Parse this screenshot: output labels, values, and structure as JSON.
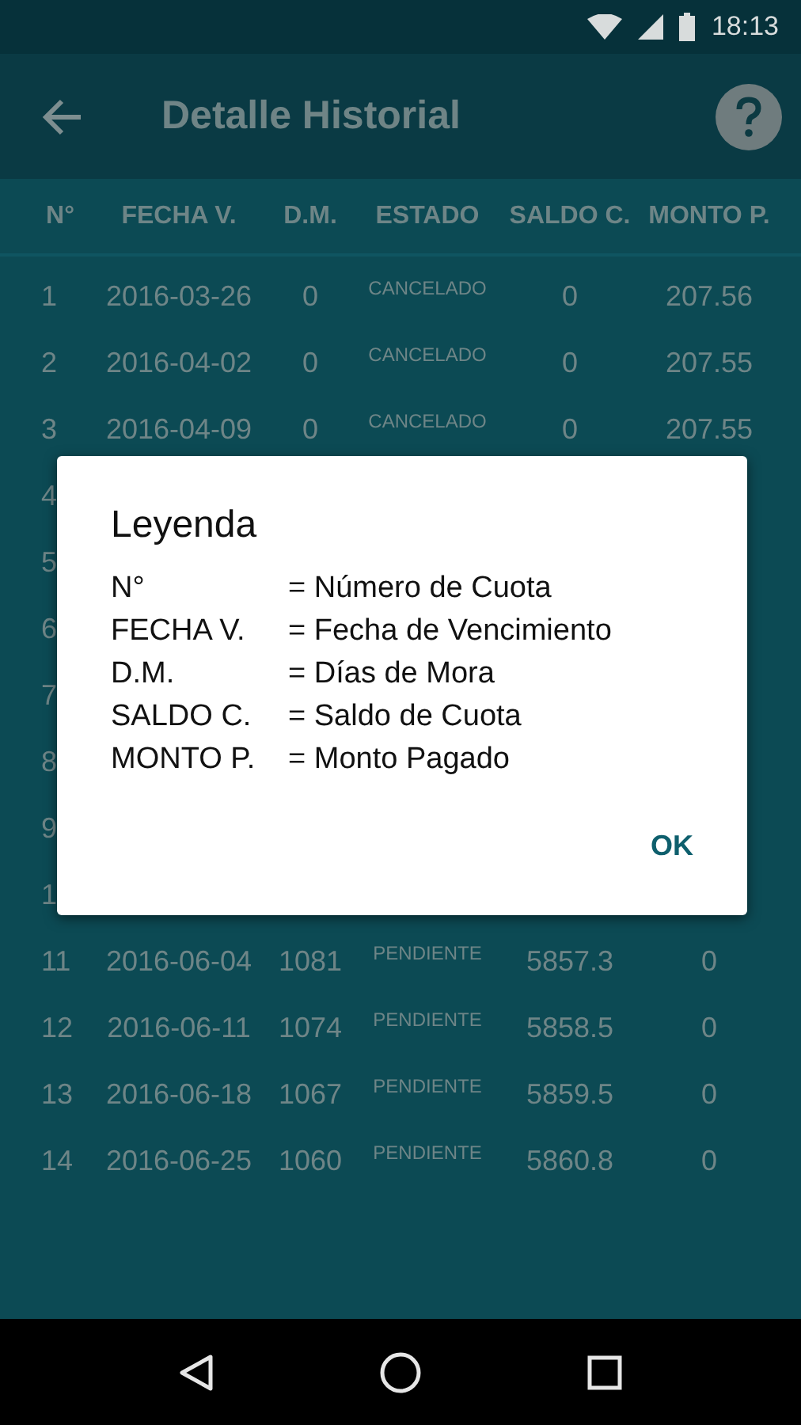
{
  "status_bar": {
    "time": "18:13"
  },
  "app_bar": {
    "title": "Detalle Historial"
  },
  "table": {
    "columns": [
      "N°",
      "FECHA V.",
      "D.M.",
      "ESTADO",
      "SALDO C.",
      "MONTO P."
    ],
    "rows": [
      {
        "n": "1",
        "fecha": "2016-03-26",
        "dm": "0",
        "estado": "CANCELADO",
        "saldo": "0",
        "monto": "207.56"
      },
      {
        "n": "2",
        "fecha": "2016-04-02",
        "dm": "0",
        "estado": "CANCELADO",
        "saldo": "0",
        "monto": "207.55"
      },
      {
        "n": "3",
        "fecha": "2016-04-09",
        "dm": "0",
        "estado": "CANCELADO",
        "saldo": "0",
        "monto": "207.55"
      },
      {
        "n": "4"
      },
      {
        "n": "5"
      },
      {
        "n": "6"
      },
      {
        "n": "7"
      },
      {
        "n": "8"
      },
      {
        "n": "9"
      },
      {
        "n": "1"
      },
      {
        "n": "11",
        "fecha": "2016-06-04",
        "dm": "1081",
        "estado": "PENDIENTE",
        "saldo": "5857.3",
        "monto": "0"
      },
      {
        "n": "12",
        "fecha": "2016-06-11",
        "dm": "1074",
        "estado": "PENDIENTE",
        "saldo": "5858.5",
        "monto": "0"
      },
      {
        "n": "13",
        "fecha": "2016-06-18",
        "dm": "1067",
        "estado": "PENDIENTE",
        "saldo": "5859.5",
        "monto": "0"
      },
      {
        "n": "14",
        "fecha": "2016-06-25",
        "dm": "1060",
        "estado": "PENDIENTE",
        "saldo": "5860.8",
        "monto": "0"
      }
    ]
  },
  "dialog": {
    "title": "Leyenda",
    "entries": [
      {
        "key": "N°",
        "meaning": "= Número de Cuota"
      },
      {
        "key": "FECHA V.",
        "meaning": "= Fecha de Vencimiento"
      },
      {
        "key": "D.M.",
        "meaning": "= Días de Mora"
      },
      {
        "key": "SALDO C.",
        "meaning": "= Saldo de Cuota"
      },
      {
        "key": "MONTO P.",
        "meaning": "= Monto Pagado"
      }
    ],
    "button": "OK"
  }
}
